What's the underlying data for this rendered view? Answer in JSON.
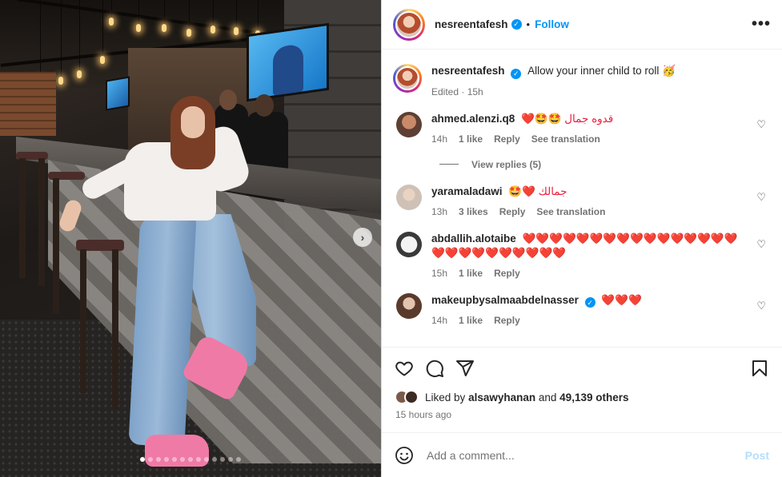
{
  "post": {
    "author": "nesreentafesh",
    "follow_label": "Follow",
    "separator": "•",
    "more_label": "•••",
    "caption_text": "Allow your inner child to roll 🥳",
    "caption_meta": "Edited · 15h",
    "carousel": {
      "slide_count": 13,
      "active_index": 0,
      "next_label": "›"
    }
  },
  "comments": [
    {
      "username": "ahmed.alenzi.q8",
      "text": "❤️🤩🤩 قدوه جمال",
      "time": "14h",
      "likes": "1 like",
      "reply": "Reply",
      "translation": "See translation",
      "avatar_color": "#a4674d",
      "view_replies": "View replies (5)"
    },
    {
      "username": "yaramaladawi",
      "text": "🤩❤️ جمالك",
      "time": "13h",
      "likes": "3 likes",
      "reply": "Reply",
      "translation": "See translation",
      "avatar_color": "#c9b8ac"
    },
    {
      "username": "abdallih.alotaibe",
      "text": "❤️❤️❤️❤️❤️❤️❤️❤️❤️❤️❤️❤️❤️❤️❤️❤️❤️❤️❤️❤️❤️❤️❤️❤️❤️❤️",
      "time": "15h",
      "likes": "1 like",
      "reply": "Reply",
      "avatar_color": "#6e6e6e"
    },
    {
      "username": "makeupbysalmaabdelnasser",
      "text": "❤️❤️❤️",
      "time": "14h",
      "likes": "1 like",
      "reply": "Reply",
      "avatar_color": "#8a7062"
    }
  ],
  "engagement": {
    "liked_by_prefix": "Liked by",
    "liked_by_user": "alsawyhanan",
    "and_label": "and",
    "others_count": "49,139 others",
    "time_ago": "15 hours ago"
  },
  "composer": {
    "placeholder": "Add a comment...",
    "post_label": "Post"
  },
  "colors": {
    "accent": "#0095f6",
    "heart": "#ed1c3c",
    "shoe": "#f07aa6"
  }
}
